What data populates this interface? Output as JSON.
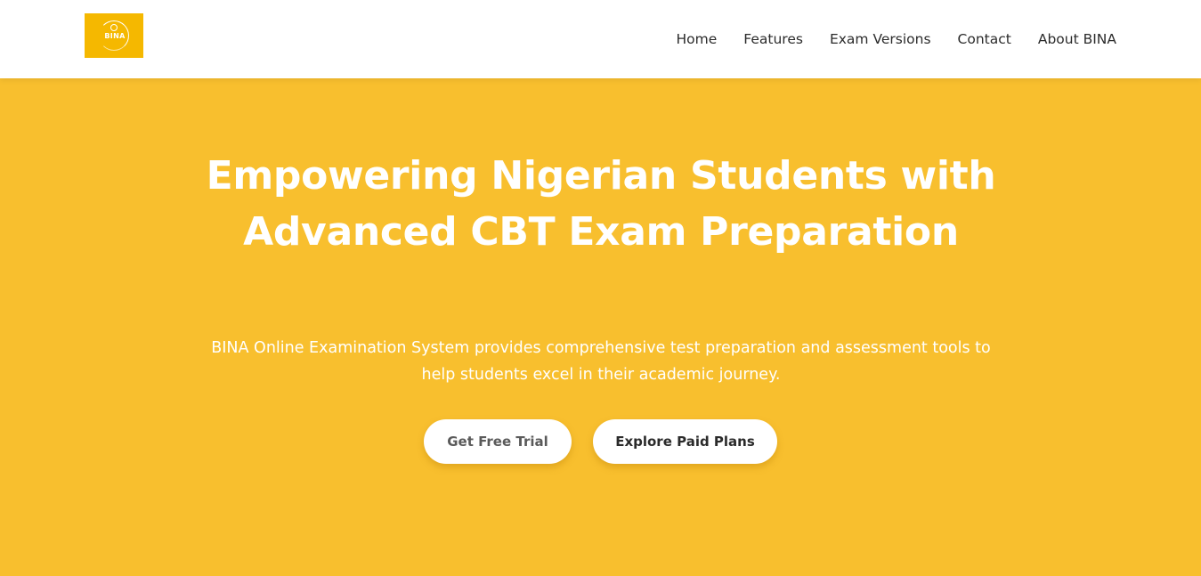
{
  "header": {
    "logo_text": "BINA",
    "nav": [
      {
        "label": "Home"
      },
      {
        "label": "Features"
      },
      {
        "label": "Exam Versions"
      },
      {
        "label": "Contact"
      },
      {
        "label": "About BINA"
      }
    ]
  },
  "hero": {
    "title": "Empowering Nigerian Students with Advanced CBT Exam Preparation",
    "subtitle": "BINA Online Examination System provides comprehensive test preparation and assessment tools to help students excel in their academic journey.",
    "primary_button": "Get Free Trial",
    "secondary_button": "Explore Paid Plans"
  },
  "colors": {
    "brand": "#f5b800",
    "hero_background": "#f8bf2e",
    "text_dark": "#2b2b2b"
  }
}
